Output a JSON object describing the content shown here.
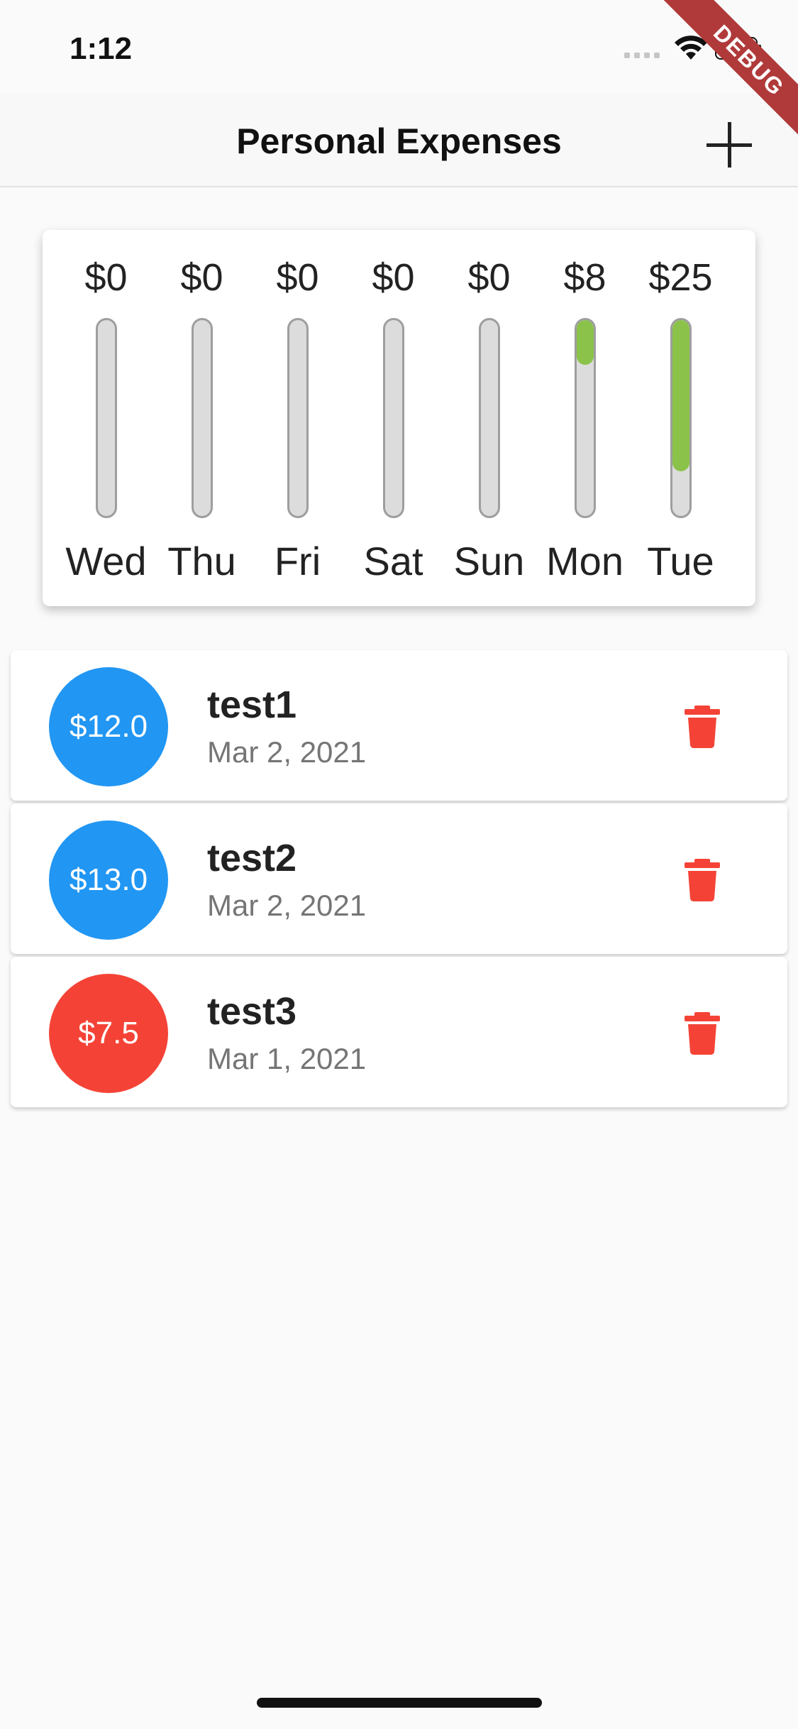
{
  "status_bar": {
    "time": "1:12"
  },
  "debug_banner": "DEBUG",
  "app_bar": {
    "title": "Personal Expenses",
    "add_icon": "plus-icon"
  },
  "chart_data": {
    "type": "bar",
    "categories": [
      "Wed",
      "Thu",
      "Fri",
      "Sat",
      "Sun",
      "Mon",
      "Tue"
    ],
    "value_labels": [
      "$0",
      "$0",
      "$0",
      "$0",
      "$0",
      "$8",
      "$25"
    ],
    "values": [
      0,
      0,
      0,
      0,
      0,
      7.5,
      25
    ],
    "fill_fraction": [
      0,
      0,
      0,
      0,
      0,
      0.23,
      0.77
    ],
    "bar_color": "#8bc34a",
    "track_color": "#dcdcdc"
  },
  "transactions": [
    {
      "amount": "$12.0",
      "title": "test1",
      "date": "Mar 2, 2021",
      "color": "#2196f3"
    },
    {
      "amount": "$13.0",
      "title": "test2",
      "date": "Mar 2, 2021",
      "color": "#2196f3"
    },
    {
      "amount": "$7.5",
      "title": "test3",
      "date": "Mar 1, 2021",
      "color": "#f44336"
    }
  ],
  "delete_icon": "trash-icon",
  "delete_color": "#f44336"
}
